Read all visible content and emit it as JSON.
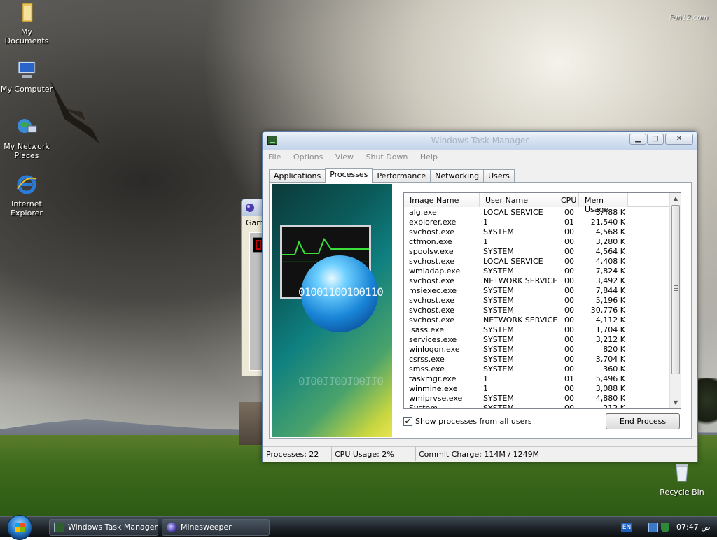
{
  "desktop": {
    "watermark": "Fun12.com",
    "icons": [
      {
        "label": "My Documents"
      },
      {
        "label": "My Computer"
      },
      {
        "label": "My Network Places"
      },
      {
        "label": "Internet Explorer"
      },
      {
        "label": "Recycle Bin"
      }
    ]
  },
  "minesweeper_window": {
    "menu_label": "Gam"
  },
  "task_manager": {
    "title": "Windows Task Manager",
    "menu": [
      "File",
      "Options",
      "View",
      "Shut Down",
      "Help"
    ],
    "tabs": [
      "Applications",
      "Processes",
      "Performance",
      "Networking",
      "Users"
    ],
    "active_tab": "Processes",
    "graphic_text": "01001100100110",
    "columns": [
      "Image Name",
      "User Name",
      "CPU",
      "Mem Usage"
    ],
    "processes": [
      {
        "name": "alg.exe",
        "user": "LOCAL SERVICE",
        "cpu": "00",
        "mem": "3,488 K"
      },
      {
        "name": "explorer.exe",
        "user": "1",
        "cpu": "01",
        "mem": "21,540 K"
      },
      {
        "name": "svchost.exe",
        "user": "SYSTEM",
        "cpu": "00",
        "mem": "4,568 K"
      },
      {
        "name": "ctfmon.exe",
        "user": "1",
        "cpu": "00",
        "mem": "3,280 K"
      },
      {
        "name": "spoolsv.exe",
        "user": "SYSTEM",
        "cpu": "00",
        "mem": "4,564 K"
      },
      {
        "name": "svchost.exe",
        "user": "LOCAL SERVICE",
        "cpu": "00",
        "mem": "4,408 K"
      },
      {
        "name": "wmiadap.exe",
        "user": "SYSTEM",
        "cpu": "00",
        "mem": "7,824 K"
      },
      {
        "name": "svchost.exe",
        "user": "NETWORK SERVICE",
        "cpu": "00",
        "mem": "3,492 K"
      },
      {
        "name": "msiexec.exe",
        "user": "SYSTEM",
        "cpu": "00",
        "mem": "7,844 K"
      },
      {
        "name": "svchost.exe",
        "user": "SYSTEM",
        "cpu": "00",
        "mem": "5,196 K"
      },
      {
        "name": "svchost.exe",
        "user": "SYSTEM",
        "cpu": "00",
        "mem": "30,776 K"
      },
      {
        "name": "svchost.exe",
        "user": "NETWORK SERVICE",
        "cpu": "00",
        "mem": "4,112 K"
      },
      {
        "name": "lsass.exe",
        "user": "SYSTEM",
        "cpu": "00",
        "mem": "1,704 K"
      },
      {
        "name": "services.exe",
        "user": "SYSTEM",
        "cpu": "00",
        "mem": "3,212 K"
      },
      {
        "name": "winlogon.exe",
        "user": "SYSTEM",
        "cpu": "00",
        "mem": "820 K"
      },
      {
        "name": "csrss.exe",
        "user": "SYSTEM",
        "cpu": "00",
        "mem": "3,704 K"
      },
      {
        "name": "smss.exe",
        "user": "SYSTEM",
        "cpu": "00",
        "mem": "360 K"
      },
      {
        "name": "taskmgr.exe",
        "user": "1",
        "cpu": "01",
        "mem": "5,496 K"
      },
      {
        "name": "winmine.exe",
        "user": "1",
        "cpu": "00",
        "mem": "3,088 K"
      },
      {
        "name": "wmiprvse.exe",
        "user": "SYSTEM",
        "cpu": "00",
        "mem": "4,880 K"
      },
      {
        "name": "System",
        "user": "SYSTEM",
        "cpu": "00",
        "mem": "212 K"
      }
    ],
    "show_all_label": "Show processes from all users",
    "show_all_checked": true,
    "end_process_label": "End Process",
    "status": {
      "processes": "Processes: 22",
      "cpu_usage": "CPU Usage: 2%",
      "commit_charge": "Commit Charge: 114M / 1249M"
    }
  },
  "taskbar": {
    "buttons": [
      "Windows Task Manager",
      "Minesweeper"
    ],
    "language": "EN",
    "clock": "07:47 ص"
  }
}
